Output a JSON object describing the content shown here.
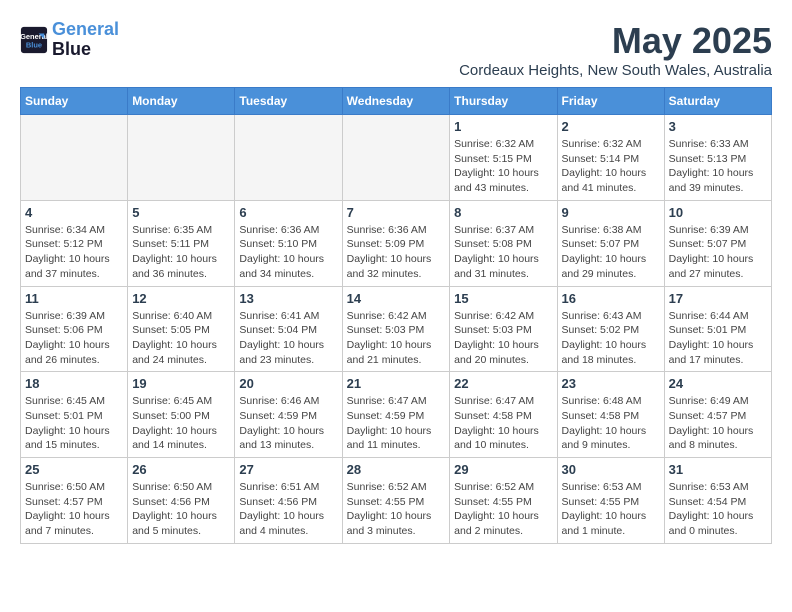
{
  "header": {
    "logo_line1": "General",
    "logo_line2": "Blue",
    "month": "May 2025",
    "location": "Cordeaux Heights, New South Wales, Australia"
  },
  "days_of_week": [
    "Sunday",
    "Monday",
    "Tuesday",
    "Wednesday",
    "Thursday",
    "Friday",
    "Saturday"
  ],
  "weeks": [
    [
      {
        "day": "",
        "info": ""
      },
      {
        "day": "",
        "info": ""
      },
      {
        "day": "",
        "info": ""
      },
      {
        "day": "",
        "info": ""
      },
      {
        "day": "1",
        "info": "Sunrise: 6:32 AM\nSunset: 5:15 PM\nDaylight: 10 hours\nand 43 minutes."
      },
      {
        "day": "2",
        "info": "Sunrise: 6:32 AM\nSunset: 5:14 PM\nDaylight: 10 hours\nand 41 minutes."
      },
      {
        "day": "3",
        "info": "Sunrise: 6:33 AM\nSunset: 5:13 PM\nDaylight: 10 hours\nand 39 minutes."
      }
    ],
    [
      {
        "day": "4",
        "info": "Sunrise: 6:34 AM\nSunset: 5:12 PM\nDaylight: 10 hours\nand 37 minutes."
      },
      {
        "day": "5",
        "info": "Sunrise: 6:35 AM\nSunset: 5:11 PM\nDaylight: 10 hours\nand 36 minutes."
      },
      {
        "day": "6",
        "info": "Sunrise: 6:36 AM\nSunset: 5:10 PM\nDaylight: 10 hours\nand 34 minutes."
      },
      {
        "day": "7",
        "info": "Sunrise: 6:36 AM\nSunset: 5:09 PM\nDaylight: 10 hours\nand 32 minutes."
      },
      {
        "day": "8",
        "info": "Sunrise: 6:37 AM\nSunset: 5:08 PM\nDaylight: 10 hours\nand 31 minutes."
      },
      {
        "day": "9",
        "info": "Sunrise: 6:38 AM\nSunset: 5:07 PM\nDaylight: 10 hours\nand 29 minutes."
      },
      {
        "day": "10",
        "info": "Sunrise: 6:39 AM\nSunset: 5:07 PM\nDaylight: 10 hours\nand 27 minutes."
      }
    ],
    [
      {
        "day": "11",
        "info": "Sunrise: 6:39 AM\nSunset: 5:06 PM\nDaylight: 10 hours\nand 26 minutes."
      },
      {
        "day": "12",
        "info": "Sunrise: 6:40 AM\nSunset: 5:05 PM\nDaylight: 10 hours\nand 24 minutes."
      },
      {
        "day": "13",
        "info": "Sunrise: 6:41 AM\nSunset: 5:04 PM\nDaylight: 10 hours\nand 23 minutes."
      },
      {
        "day": "14",
        "info": "Sunrise: 6:42 AM\nSunset: 5:03 PM\nDaylight: 10 hours\nand 21 minutes."
      },
      {
        "day": "15",
        "info": "Sunrise: 6:42 AM\nSunset: 5:03 PM\nDaylight: 10 hours\nand 20 minutes."
      },
      {
        "day": "16",
        "info": "Sunrise: 6:43 AM\nSunset: 5:02 PM\nDaylight: 10 hours\nand 18 minutes."
      },
      {
        "day": "17",
        "info": "Sunrise: 6:44 AM\nSunset: 5:01 PM\nDaylight: 10 hours\nand 17 minutes."
      }
    ],
    [
      {
        "day": "18",
        "info": "Sunrise: 6:45 AM\nSunset: 5:01 PM\nDaylight: 10 hours\nand 15 minutes."
      },
      {
        "day": "19",
        "info": "Sunrise: 6:45 AM\nSunset: 5:00 PM\nDaylight: 10 hours\nand 14 minutes."
      },
      {
        "day": "20",
        "info": "Sunrise: 6:46 AM\nSunset: 4:59 PM\nDaylight: 10 hours\nand 13 minutes."
      },
      {
        "day": "21",
        "info": "Sunrise: 6:47 AM\nSunset: 4:59 PM\nDaylight: 10 hours\nand 11 minutes."
      },
      {
        "day": "22",
        "info": "Sunrise: 6:47 AM\nSunset: 4:58 PM\nDaylight: 10 hours\nand 10 minutes."
      },
      {
        "day": "23",
        "info": "Sunrise: 6:48 AM\nSunset: 4:58 PM\nDaylight: 10 hours\nand 9 minutes."
      },
      {
        "day": "24",
        "info": "Sunrise: 6:49 AM\nSunset: 4:57 PM\nDaylight: 10 hours\nand 8 minutes."
      }
    ],
    [
      {
        "day": "25",
        "info": "Sunrise: 6:50 AM\nSunset: 4:57 PM\nDaylight: 10 hours\nand 7 minutes."
      },
      {
        "day": "26",
        "info": "Sunrise: 6:50 AM\nSunset: 4:56 PM\nDaylight: 10 hours\nand 5 minutes."
      },
      {
        "day": "27",
        "info": "Sunrise: 6:51 AM\nSunset: 4:56 PM\nDaylight: 10 hours\nand 4 minutes."
      },
      {
        "day": "28",
        "info": "Sunrise: 6:52 AM\nSunset: 4:55 PM\nDaylight: 10 hours\nand 3 minutes."
      },
      {
        "day": "29",
        "info": "Sunrise: 6:52 AM\nSunset: 4:55 PM\nDaylight: 10 hours\nand 2 minutes."
      },
      {
        "day": "30",
        "info": "Sunrise: 6:53 AM\nSunset: 4:55 PM\nDaylight: 10 hours\nand 1 minute."
      },
      {
        "day": "31",
        "info": "Sunrise: 6:53 AM\nSunset: 4:54 PM\nDaylight: 10 hours\nand 0 minutes."
      }
    ]
  ]
}
